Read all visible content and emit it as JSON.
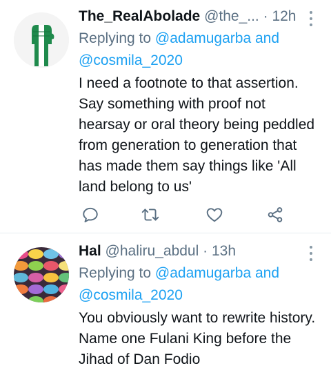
{
  "tweets": [
    {
      "display_name": "The_RealAbolade",
      "handle": "@the_...",
      "separator": "·",
      "time": "12h",
      "replying_prefix": "Replying to ",
      "replying_mention_1": "@adamugarba",
      "replying_and": " and",
      "replying_mention_2": "@cosmila_2020",
      "text": "I need a footnote to that assertion. Say something with proof not hearsay or oral theory being peddled from generation to generation that has made them say things like 'All land belong to us'",
      "avatar": "raised-fist-avatar",
      "actions": [
        "reply-icon",
        "retweet-icon",
        "like-icon",
        "share-icon"
      ]
    },
    {
      "display_name": "Hal",
      "handle": "@haliru_abdul",
      "separator": "·",
      "time": "13h",
      "replying_prefix": "Replying to ",
      "replying_mention_1": "@adamugarba",
      "replying_and": " and",
      "replying_mention_2": "@cosmila_2020",
      "text": "You obviously want to rewrite history. Name one Fulani King before the Jihad of Dan Fodio",
      "avatar": "macarons-avatar"
    }
  ],
  "colors": {
    "text": "#0f1419",
    "secondary": "#5b7083",
    "accent": "#1da1f2",
    "divider": "#e6ecf0",
    "flag_green": "#1f8a4c"
  }
}
